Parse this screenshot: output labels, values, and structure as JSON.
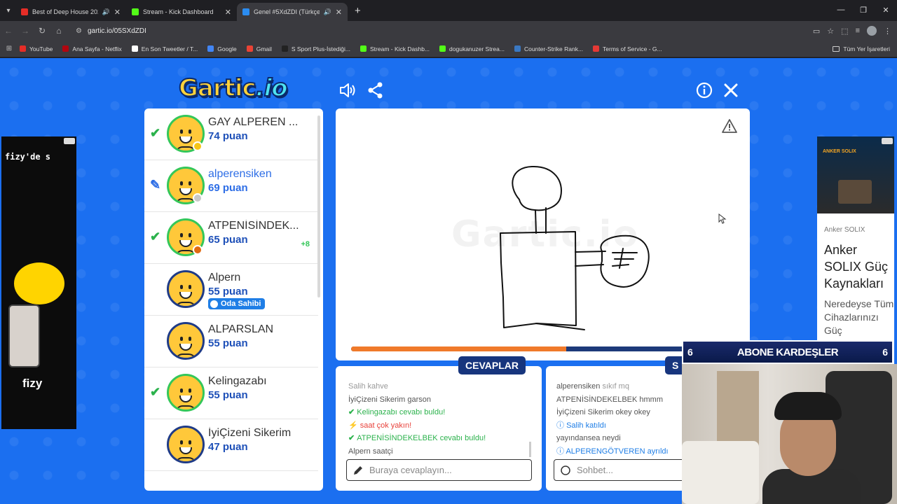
{
  "browser": {
    "tabs": [
      {
        "title": "Best of Deep House 2025 | ...",
        "color": "#e52d27",
        "active": false,
        "audio": true
      },
      {
        "title": "Stream - Kick Dashboard",
        "color": "#53fc18",
        "active": false,
        "audio": false
      },
      {
        "title": "Genel #5XdZDI (Türkçe) - G...",
        "color": "#2b8cf0",
        "active": true,
        "audio": true
      }
    ],
    "url": "gartic.io/05SXdZDI",
    "bookmarks": [
      {
        "label": "YouTube",
        "color": "#e52d27"
      },
      {
        "label": "Ana Sayfa - Netflix",
        "color": "#b1060f"
      },
      {
        "label": "En Son Tweetler / T...",
        "color": "#ffffff"
      },
      {
        "label": "Google",
        "color": "#4285f4"
      },
      {
        "label": "Gmail",
        "color": "#ea4335"
      },
      {
        "label": "S Sport Plus-İstediği...",
        "color": "#222222"
      },
      {
        "label": "Stream - Kick Dashb...",
        "color": "#53fc18"
      },
      {
        "label": "dogukanuzer Strea...",
        "color": "#53fc18"
      },
      {
        "label": "Counter-Strike Rank...",
        "color": "#3a78c2"
      },
      {
        "label": "Terms of Service - G...",
        "color": "#e53935"
      }
    ],
    "all_bookmarks": "Tüm Yer İşaretleri"
  },
  "game": {
    "logo_main": "Gartic",
    "logo_suffix": ".io",
    "watermark": "Gartic.io",
    "progress": 0.59,
    "players": [
      {
        "name": "GAY ALPEREN ...",
        "score": "74 puan",
        "status": "check",
        "dot": "#f5c518",
        "ring": "green"
      },
      {
        "name": "alperensiken",
        "score": "69 puan",
        "status": "pencil",
        "dot": "#c9c9c9",
        "ring": "green",
        "me": true
      },
      {
        "name": "ATPENİSİNDEK...",
        "score": "65 puan",
        "status": "check",
        "dot": "#e06a10",
        "ring": "green",
        "bonus": "+8"
      },
      {
        "name": "Alpern",
        "score": "55 puan",
        "status": "",
        "ring": "dark",
        "owner": "Oda Sahibi"
      },
      {
        "name": "ALPARSLAN",
        "score": "55 puan",
        "status": "",
        "ring": "dark"
      },
      {
        "name": "Kelingazabı",
        "score": "55 puan",
        "status": "check",
        "ring": "green"
      },
      {
        "name": "İyiÇizeni Sikerim",
        "score": "47 puan",
        "status": "",
        "ring": "dark"
      }
    ],
    "answers": {
      "tab": "CEVAPLAR",
      "placeholder": "Buraya cevaplayın...",
      "messages": [
        {
          "text": "Salih kahve",
          "type": "fade"
        },
        {
          "who": "İyiÇizeni Sikerim",
          "text": "garson",
          "type": "normal"
        },
        {
          "who": "Kelingazabı",
          "text": "cevabı buldu!",
          "type": "green"
        },
        {
          "who": "saat",
          "text": "çok yakın!",
          "type": "red"
        },
        {
          "who": "ATPENİSİNDEKELBEK",
          "text": "cevabı buldu!",
          "type": "green"
        },
        {
          "who": "Alpern",
          "text": "saatçi",
          "type": "normal"
        }
      ]
    },
    "chat": {
      "tab": "S",
      "placeholder": "Sohbet...",
      "messages": [
        {
          "who": "alperensiken",
          "text": "sıkıf mq",
          "type": "fade"
        },
        {
          "who": "ATPENİSİNDEKELBEK",
          "text": "hmmm",
          "type": "normal"
        },
        {
          "who": "İyiÇizeni Sikerim",
          "text": "okey okey",
          "type": "normal"
        },
        {
          "who": "Salih",
          "text": "katıldı",
          "type": "blue"
        },
        {
          "who": "",
          "text": "yayındansea neydi",
          "type": "normal"
        },
        {
          "who": "ALPERENGÖTVEREN",
          "text": "ayrıldı",
          "type": "blue"
        }
      ]
    }
  },
  "ads": {
    "left_brand": "fizy'de s",
    "left_logo": "fizy",
    "right_headline_small": "ANKER SOLIX",
    "right_source": "Anker SOLIX",
    "right_title": "Anker SOLIX Güç Kaynakları",
    "right_sub": "Neredeyse Tüm Cihazlarınızı Güç"
  },
  "overlay": {
    "left_num": "6",
    "title": "ABONE KARDEŞLER",
    "right_num": "6"
  }
}
